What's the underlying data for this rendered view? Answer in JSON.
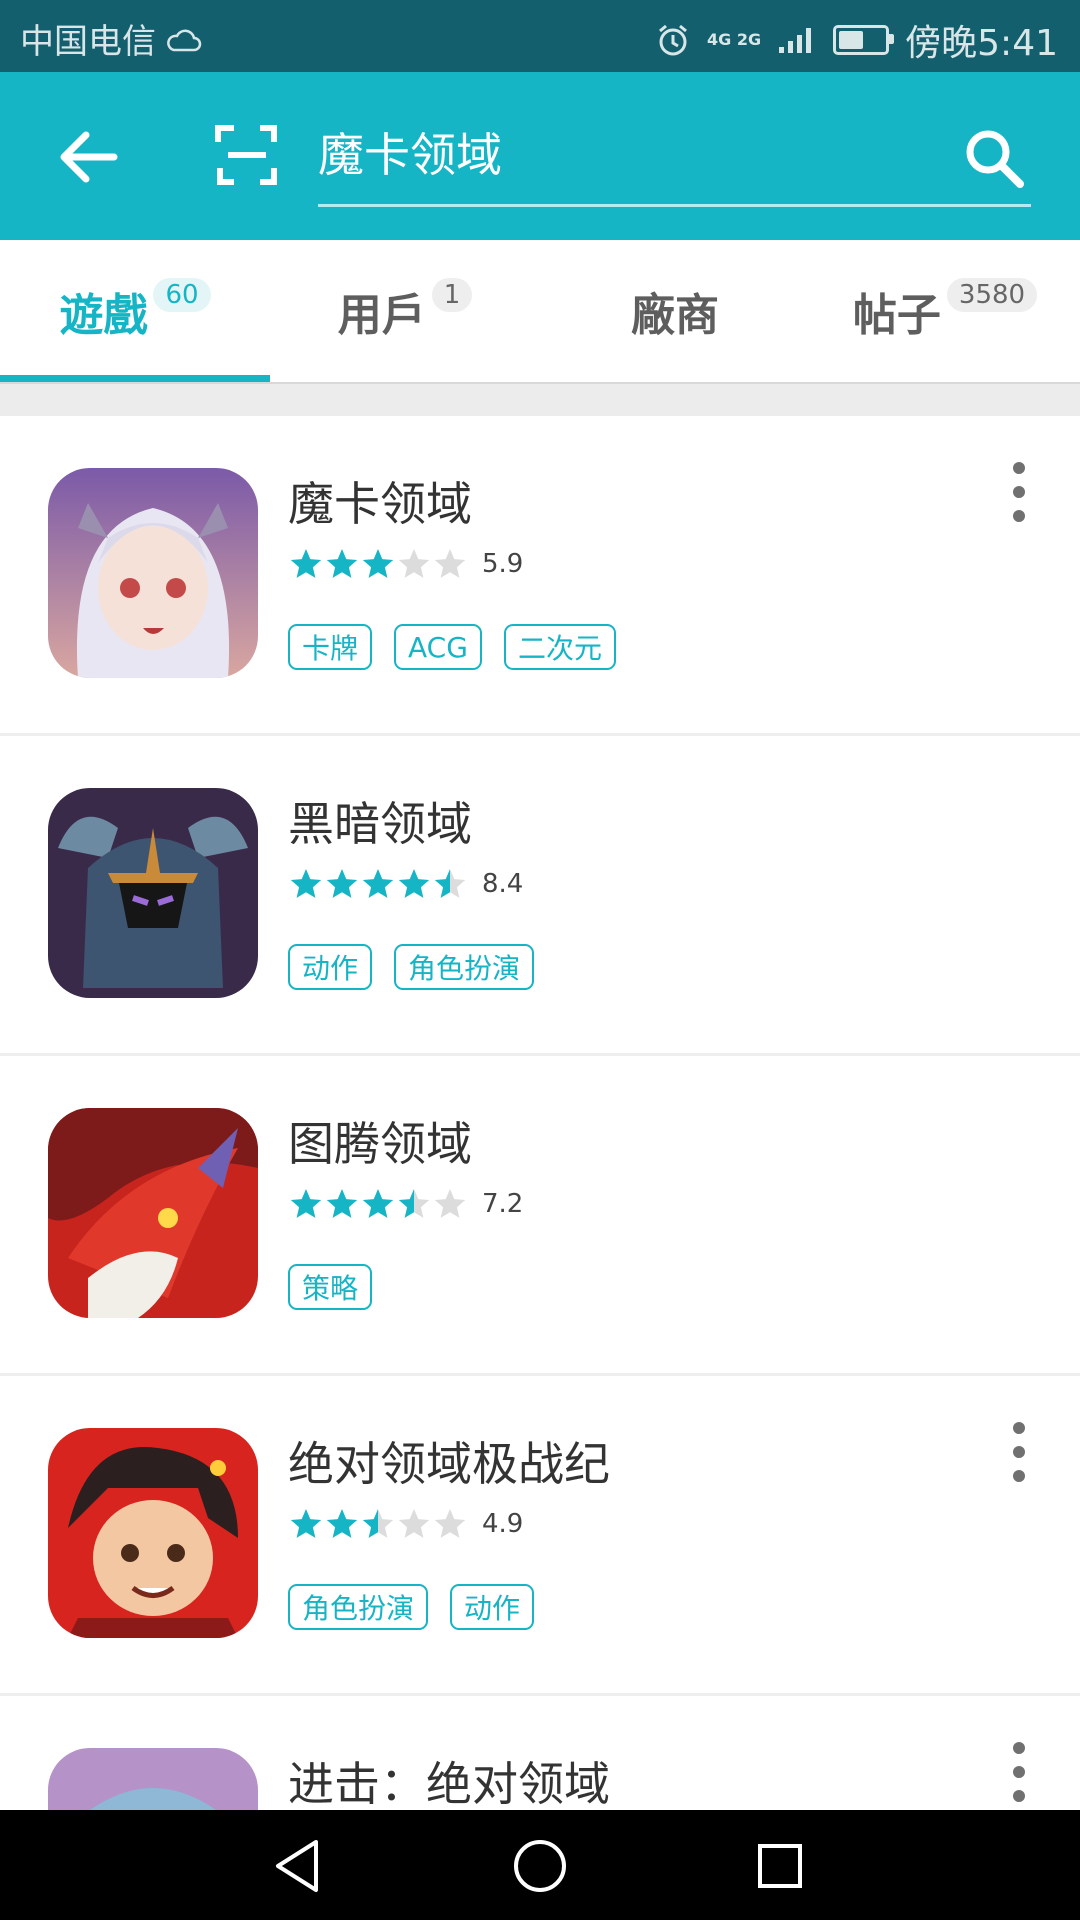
{
  "status_bar": {
    "carrier": "中国电信",
    "network": "4G 2G",
    "time": "傍晚5:41",
    "battery_level": 0.55
  },
  "search": {
    "query": "魔卡领域",
    "placeholder": ""
  },
  "tabs": [
    {
      "label": "遊戲",
      "count": "60",
      "active": true
    },
    {
      "label": "用戶",
      "count": "1",
      "active": false
    },
    {
      "label": "廠商",
      "count": "",
      "active": false
    },
    {
      "label": "帖子",
      "count": "3580",
      "active": false
    }
  ],
  "results": [
    {
      "name": "魔卡领域",
      "rating": "5.9",
      "stars": 3,
      "tags": [
        "卡牌",
        "ACG",
        "二次元"
      ],
      "has_menu": true
    },
    {
      "name": "黑暗领域",
      "rating": "8.4",
      "stars": 4.5,
      "tags": [
        "动作",
        "角色扮演"
      ],
      "has_menu": false
    },
    {
      "name": "图腾领域",
      "rating": "7.2",
      "stars": 3.5,
      "tags": [
        "策略"
      ],
      "has_menu": false
    },
    {
      "name": "绝对领域极战纪",
      "rating": "4.9",
      "stars": 2.5,
      "tags": [
        "角色扮演",
        "动作"
      ],
      "has_menu": true
    },
    {
      "name": "进击：绝对领域",
      "rating": "",
      "stars": 0,
      "tags": [],
      "has_menu": true
    }
  ],
  "colors": {
    "accent": "#16b5c6",
    "status_bar": "#145f6e",
    "star_empty": "#dcdcdc"
  },
  "icons": {
    "back": "arrow-left-icon",
    "scan": "scan-icon",
    "search": "search-icon",
    "more": "more-vertical-icon",
    "nav_back": "triangle-back-icon",
    "nav_home": "circle-home-icon",
    "nav_recent": "square-recent-icon"
  }
}
